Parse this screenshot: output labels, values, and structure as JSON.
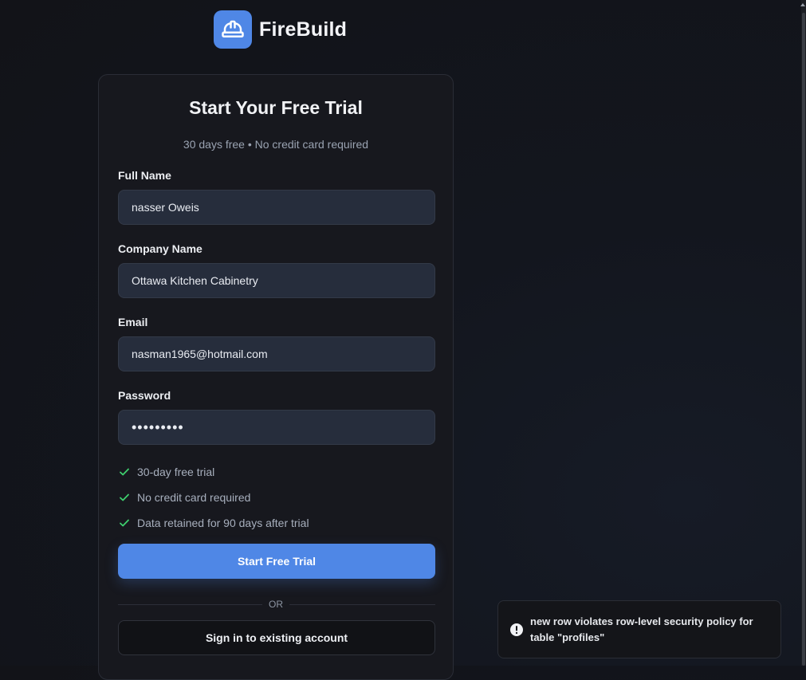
{
  "brand": {
    "name": "FireBuild",
    "logo_icon": "hard-hat-icon",
    "accent_color": "#4f87e6"
  },
  "signup": {
    "title": "Start Your Free Trial",
    "subtitle": "30 days free • No credit card required",
    "fields": {
      "full_name": {
        "label": "Full Name",
        "value": "nasser Oweis"
      },
      "company_name": {
        "label": "Company Name",
        "value": "Ottawa Kitchen Cabinetry"
      },
      "email": {
        "label": "Email",
        "value": "nasman1965@hotmail.com"
      },
      "password": {
        "label": "Password",
        "value": "•••••••••"
      }
    },
    "benefits": [
      {
        "icon": "check-icon",
        "text": "30-day free trial"
      },
      {
        "icon": "check-icon",
        "text": "No credit card required"
      },
      {
        "icon": "check-icon",
        "text": "Data retained for 90 days after trial"
      }
    ],
    "primary_button": "Start Free Trial",
    "divider_text": "OR",
    "secondary_button": "Sign in to existing account"
  },
  "toast": {
    "icon": "alert-circle-icon",
    "message": "new row violates row-level security policy for table \"profiles\""
  }
}
